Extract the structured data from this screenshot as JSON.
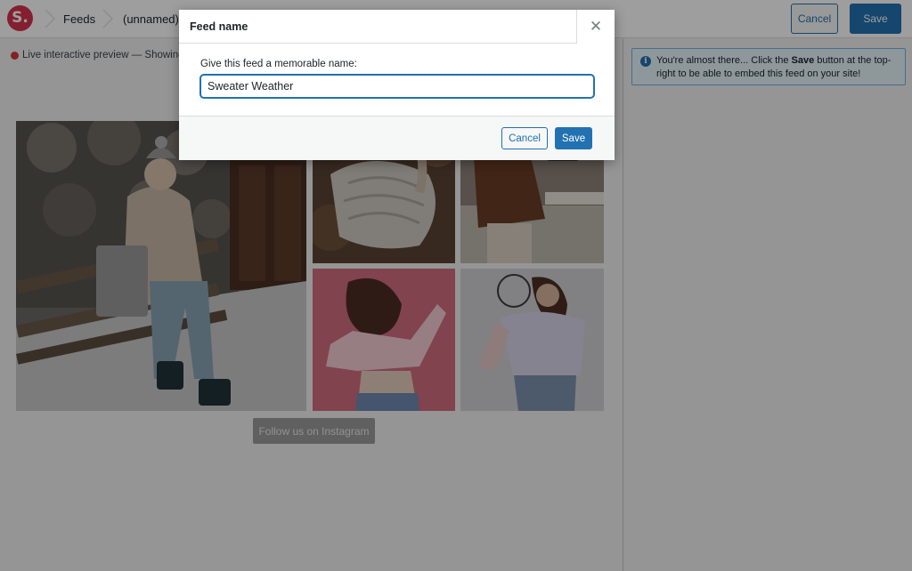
{
  "topbar": {
    "logo_letter": "S.",
    "breadcrumbs": [
      "Feeds",
      "(unnamed)"
    ],
    "cancel_label": "Cancel",
    "save_label": "Save"
  },
  "preview": {
    "live_text": "Live interactive preview — Showing",
    "follow_button_label": "Follow us on Instagram"
  },
  "sidebar": {
    "notice": {
      "text_before": "You're almost there... Click the ",
      "text_bold": "Save",
      "text_after": " button at the top-right to be able to embed this feed on your site!",
      "icon": "info-icon"
    }
  },
  "modal": {
    "title": "Feed name",
    "close_icon": "close-icon",
    "field_label": "Give this feed a memorable name:",
    "field_value": "Sweater Weather",
    "cancel_label": "Cancel",
    "save_label": "Save"
  },
  "colors": {
    "brand": "#d6334e",
    "accent": "#2271b1",
    "live_dot": "#d63638",
    "notice_bg": "#e5f5fa"
  }
}
